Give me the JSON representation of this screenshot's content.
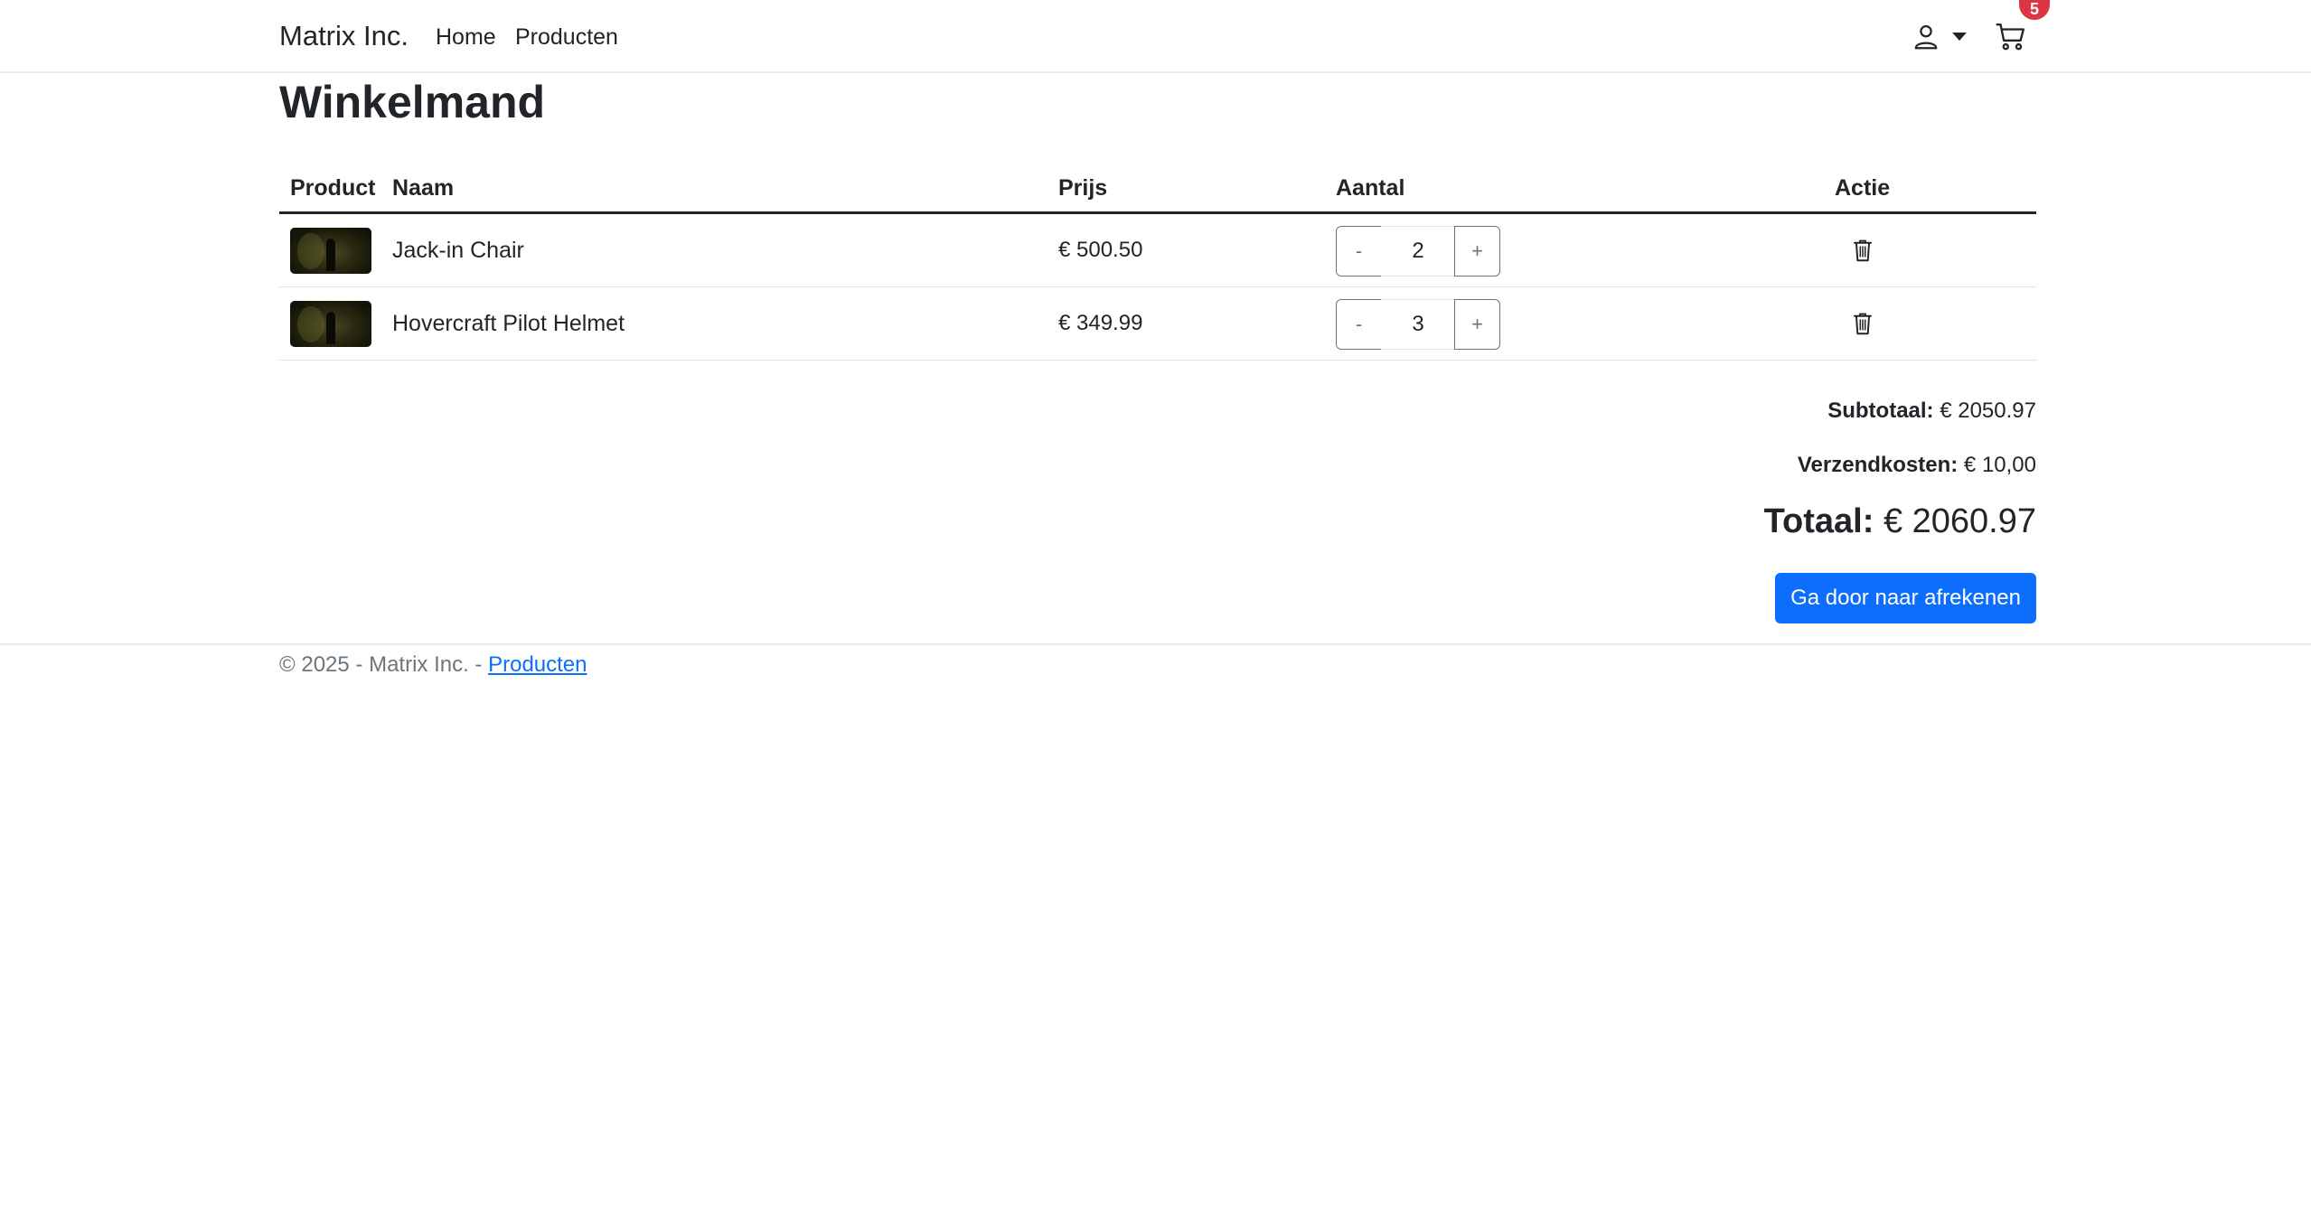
{
  "navbar": {
    "brand": "Matrix Inc.",
    "links": [
      {
        "label": "Home"
      },
      {
        "label": "Producten"
      }
    ],
    "user_icon": "person-icon",
    "cart_icon": "cart-icon",
    "cart_count": "5"
  },
  "page": {
    "title": "Winkelmand"
  },
  "table": {
    "headers": [
      "Product",
      "Naam",
      "Prijs",
      "Aantal",
      "Actie"
    ],
    "rows": [
      {
        "name": "Jack-in Chair",
        "price": "€ 500.50",
        "quantity": "2",
        "minus": "-",
        "plus": "+"
      },
      {
        "name": "Hovercraft Pilot Helmet",
        "price": "€ 349.99",
        "quantity": "3",
        "minus": "-",
        "plus": "+"
      }
    ]
  },
  "summary": {
    "subtotal_label": "Subtotaal:",
    "subtotal_value": "€ 2050.97",
    "shipping_label": "Verzendkosten:",
    "shipping_value": "€ 10,00",
    "total_label": "Totaal:",
    "total_value": "€ 2060.97",
    "checkout_label": "Ga door naar afrekenen"
  },
  "footer": {
    "text": "© 2025 - Matrix Inc. - ",
    "link": "Producten"
  },
  "colors": {
    "primary": "#0d6efd",
    "badge": "#dc3545",
    "text": "#212529",
    "muted": "#6c757d"
  }
}
